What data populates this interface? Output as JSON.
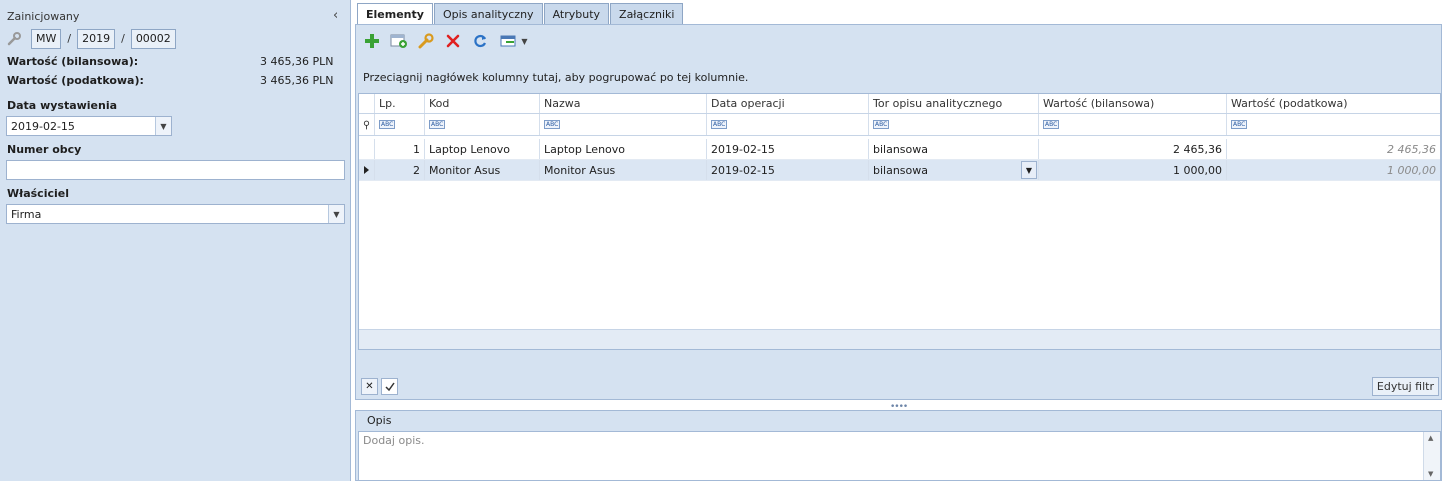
{
  "header": {
    "status": "Zainicjowany",
    "number": {
      "prefix": "MW",
      "year": "2019",
      "seq": "00002",
      "sep": "/"
    }
  },
  "summary": {
    "balance_label": "Wartość (bilansowa):",
    "balance_value": "3 465,36 PLN",
    "tax_label": "Wartość (podatkowa):",
    "tax_value": "3 465,36 PLN"
  },
  "form": {
    "issue_date_label": "Data wystawienia",
    "issue_date_value": "2019-02-15",
    "foreign_number_label": "Numer obcy",
    "foreign_number_value": "",
    "owner_label": "Właściciel",
    "owner_value": "Firma"
  },
  "tabs": [
    "Elementy",
    "Opis analityczny",
    "Atrybuty",
    "Załączniki"
  ],
  "toolbar_icons": [
    "add-icon",
    "add-from-list-icon",
    "edit-icon",
    "delete-icon",
    "refresh-icon",
    "export-icon"
  ],
  "grid": {
    "group_hint": "Przeciągnij nagłówek kolumny tutaj, aby pogrupować po tej kolumnie.",
    "columns": [
      "Lp.",
      "Kod",
      "Nazwa",
      "Data operacji",
      "Tor opisu analitycznego",
      "Wartość (bilansowa)",
      "Wartość (podatkowa)"
    ],
    "filter_placeholder": "ABC",
    "rows": [
      {
        "lp": "1",
        "kod": "Laptop Lenovo",
        "nazwa": "Laptop Lenovo",
        "data": "2019-02-15",
        "tor": "bilansowa",
        "bil": "2 465,36",
        "pod": "2 465,36"
      },
      {
        "lp": "2",
        "kod": "Monitor Asus",
        "nazwa": "Monitor Asus",
        "data": "2019-02-15",
        "tor": "bilansowa",
        "bil": "1 000,00",
        "pod": "1 000,00"
      }
    ],
    "edit_filter": "Edytuj filtr"
  },
  "description": {
    "title": "Opis",
    "placeholder": "Dodaj opis."
  },
  "colors": {
    "panel_bg": "#d5e2f1",
    "border": "#a3b9d6",
    "selected_row": "#dbe6f3"
  }
}
